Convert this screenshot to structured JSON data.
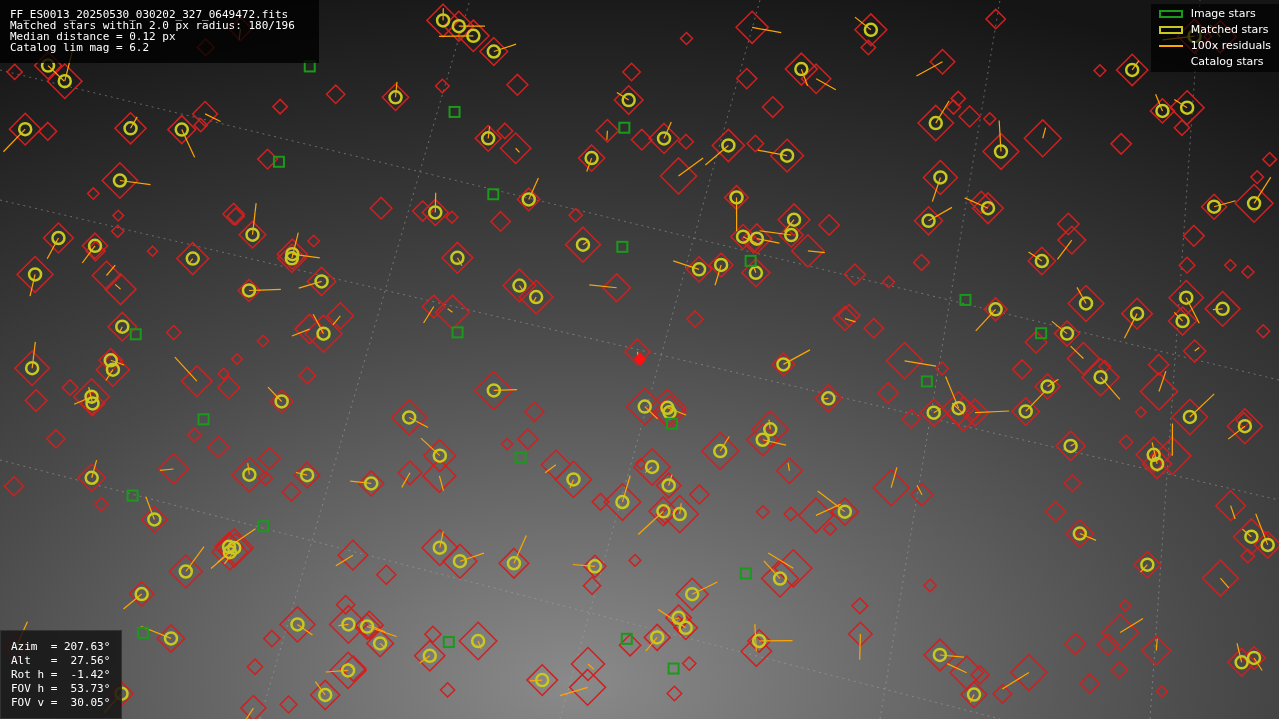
{
  "info_box": {
    "lines": [
      "FF_ES0013_20250530_030202_327_0649472.fits",
      "Matched stars within 2.0 px radius: 180/196",
      "Median distance = 0.12 px",
      "Catalog lim mag = 6.2"
    ]
  },
  "legend": [
    {
      "label": "Image stars",
      "kind": "image_box"
    },
    {
      "label": "Matched stars",
      "kind": "matched_box"
    },
    {
      "label": "100x residuals",
      "kind": "line"
    },
    {
      "label": "Catalog stars",
      "kind": "none"
    }
  ],
  "pointing_box": {
    "lines": [
      "Azim  = 207.63°",
      "Alt   =  27.56°",
      "Rot h =  -1.42°",
      "FOV h =  53.73°",
      "FOV v =  30.05°"
    ]
  }
}
